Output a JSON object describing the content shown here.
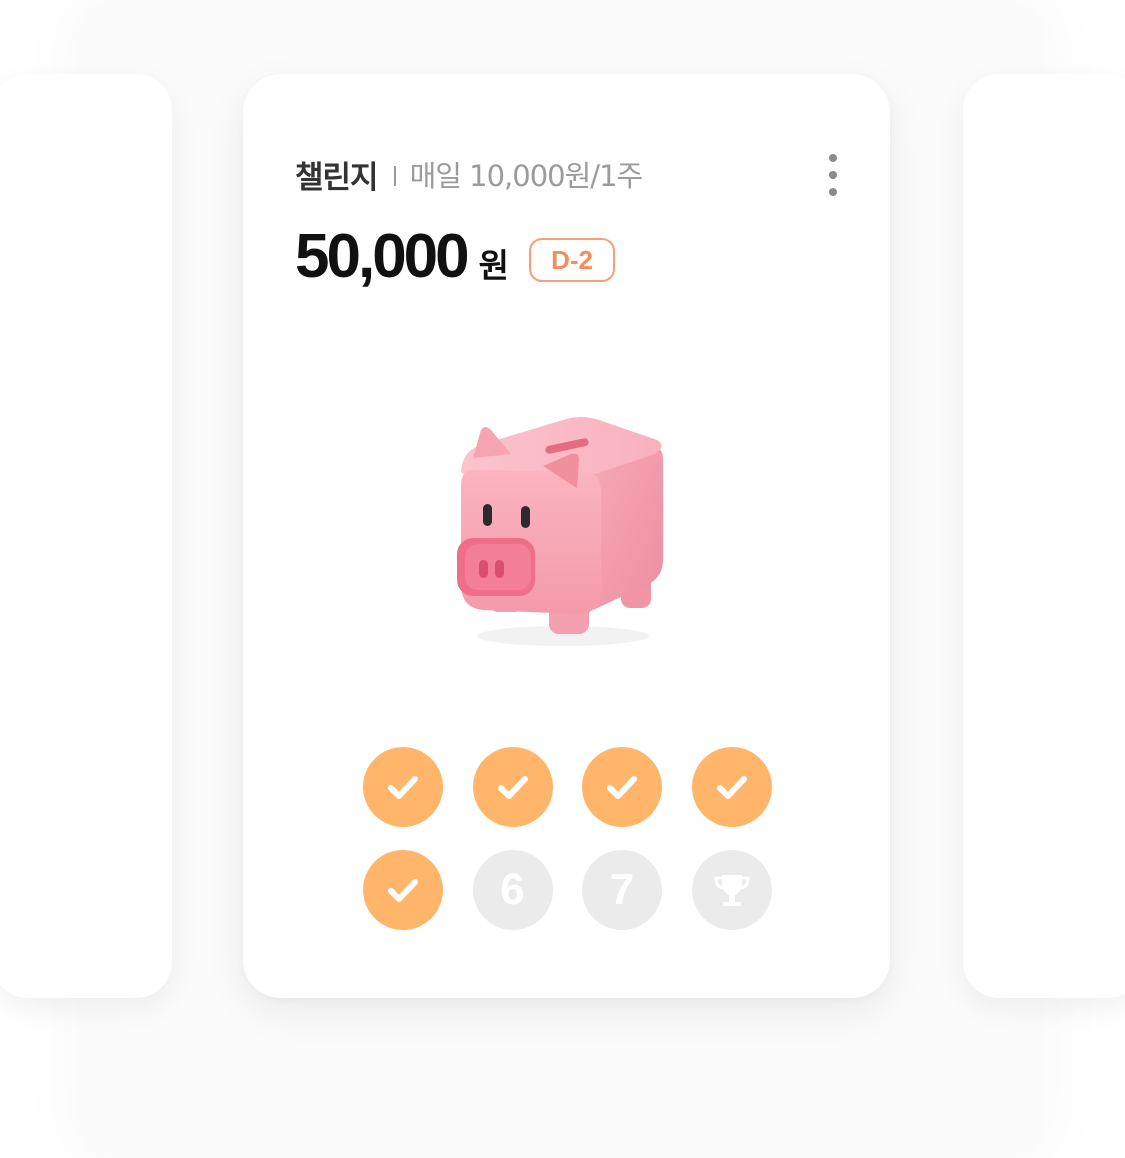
{
  "challenge": {
    "label": "챌린지",
    "plan": "매일 10,000원/1주",
    "amount": "50,000",
    "currency": "원",
    "dday": "D-2"
  },
  "icons": {
    "menu": "more-vertical-icon",
    "illustration": "piggy-bank-icon",
    "done": "checkmark-icon",
    "goal": "trophy-icon"
  },
  "stamps": [
    {
      "state": "done"
    },
    {
      "state": "done"
    },
    {
      "state": "done"
    },
    {
      "state": "done"
    },
    {
      "state": "done"
    },
    {
      "state": "pending",
      "label": "6"
    },
    {
      "state": "pending",
      "label": "7"
    },
    {
      "state": "goal"
    }
  ],
  "colors": {
    "accent": "#ffb66a",
    "badge": "#f58e5f",
    "pending": "#ebebeb",
    "pig": "#f7a8b5"
  }
}
